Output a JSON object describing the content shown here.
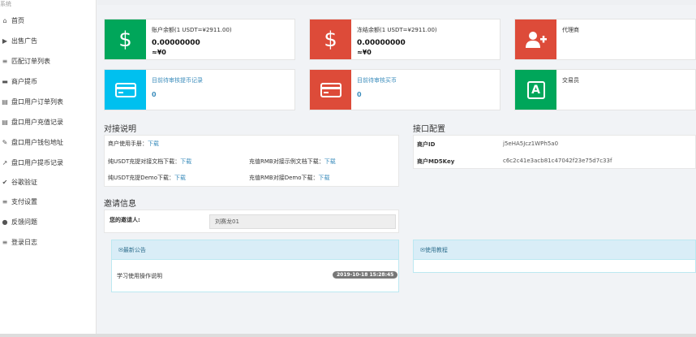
{
  "sidebar": {
    "top_label": "系统",
    "items": [
      {
        "label": "首页",
        "icon": "home-icon",
        "glyph": "⌂"
      },
      {
        "label": "出售广告",
        "icon": "bullhorn-icon",
        "glyph": "▶"
      },
      {
        "label": "匹配订单列表",
        "icon": "list-icon",
        "glyph": "≡"
      },
      {
        "label": "商户提币",
        "icon": "card-icon",
        "glyph": "▬"
      },
      {
        "label": "盘口用户订单列表",
        "icon": "list-icon",
        "glyph": "▤"
      },
      {
        "label": "盘口用户充值记录",
        "icon": "file-icon",
        "glyph": "▤"
      },
      {
        "label": "盘口用户钱包地址",
        "icon": "edit-icon",
        "glyph": "✎"
      },
      {
        "label": "盘口用户提币记录",
        "icon": "external-icon",
        "glyph": "↗"
      },
      {
        "label": "谷歌验证",
        "icon": "google-icon",
        "glyph": "✔"
      },
      {
        "label": "支付设置",
        "icon": "settings-icon",
        "glyph": "≡"
      },
      {
        "label": "反馈问题",
        "icon": "comment-icon",
        "glyph": "●"
      },
      {
        "label": "登录日志",
        "icon": "list-icon",
        "glyph": "≡"
      }
    ]
  },
  "cards": {
    "balance": {
      "label": "账户余额(1 USDT=¥2911.00)",
      "value": "0.00000000",
      "value2": "≈¥0",
      "glyph": "$",
      "color": "#00a65a"
    },
    "frozen": {
      "label": "冻结余额(1 USDT=¥2911.00)",
      "value": "0.00000000",
      "value2": "≈¥0",
      "glyph": "$",
      "color": "#dd4b39"
    },
    "agent": {
      "label": "代理商",
      "color": "#dd4b39"
    },
    "pending_withdraw": {
      "label": "目前待审核提币记录",
      "value": "0",
      "color": "#00c0ef"
    },
    "pending_buy": {
      "label": "目前待审核买币",
      "value": "0",
      "color": "#dd4b39"
    },
    "exchange": {
      "label": "交易员",
      "glyph": "A",
      "color": "#00a65a"
    }
  },
  "integration": {
    "title": "对接说明",
    "manual_label": "商户使用手册：",
    "download": "下载",
    "usdt_doc": "纯USDT充提对接文档下载：",
    "rmb_doc": "充值RMB对接示例文档下载：",
    "usdt_demo": "纯USDT充提Demo下载：",
    "rmb_demo": "充值RMB对接Demo下载："
  },
  "api": {
    "title": "接口配置",
    "merchant_id_label": "商户ID",
    "merchant_id": "j5eHA5Jcz1WPh5a0",
    "md5_label": "商户MD5Key",
    "md5": "c6c2c41e3acb81c47042f23e75d7c33f"
  },
  "invite": {
    "title": "邀请信息",
    "label": "您的邀请人:",
    "value": "刘赛龙01"
  },
  "notice": {
    "title": "✉最新公告",
    "item": "学习使用操作说明",
    "date": "2019-10-18 15:28:45"
  },
  "usage": {
    "title": "✉使用教程"
  }
}
